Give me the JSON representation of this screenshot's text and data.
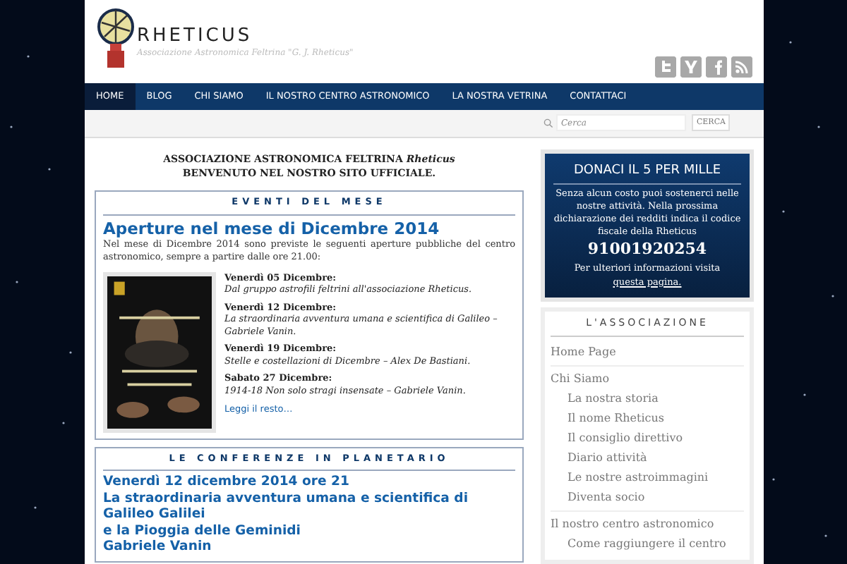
{
  "header": {
    "title": "RHETICUS",
    "subtitle": "Associazione Astronomica Feltrina \"G. J. Rheticus\""
  },
  "nav": [
    {
      "label": "HOME",
      "selected": true
    },
    {
      "label": "BLOG",
      "selected": false
    },
    {
      "label": "CHI SIAMO",
      "selected": false
    },
    {
      "label": "IL NOSTRO CENTRO ASTRONOMICO",
      "selected": false
    },
    {
      "label": "LA NOSTRA VETRINA",
      "selected": false
    },
    {
      "label": "CONTATTACI",
      "selected": false
    }
  ],
  "search": {
    "placeholder": "Cerca",
    "button": "CERCA"
  },
  "intro": [
    "ASSOCIAZIONE ASTRONOMICA FELTRINA *Rheticus*",
    "BENVENUTO NEL NOSTRO SITO UFFICIALE."
  ],
  "events": {
    "heading": "EVENTI DEL MESE",
    "title": "Aperture nel mese di Dicembre 2014",
    "text": "Nel mese di Dicembre 2014 sono previste le seguenti aperture pubbliche del centro astronomico, sempre a partire dalle ore 21.00:",
    "items": [
      {
        "date": "Venerdì 05 Dicembre:",
        "desc": "Dal gruppo astrofili feltrini all'associazione Rheticus."
      },
      {
        "date": "Venerdì 12 Dicembre:",
        "desc": "La straordinaria avventura umana e scientifica di Galileo – Gabriele Vanin."
      },
      {
        "date": "Venerdì 19 Dicembre:",
        "desc": "Stelle e costellazioni di Dicembre – Alex De Bastiani."
      },
      {
        "date": "Sabato 27 Dicembre:",
        "desc": "1914-18 Non solo stragi insensate – Gabriele Vanin."
      }
    ],
    "more": "Leggi il resto…"
  },
  "conferences": {
    "heading": "LE CONFERENZE IN PLANETARIO",
    "lines": [
      "Venerdì 12 dicembre 2014 ore 21",
      "La straordinaria avventura umana e scientifica di Galileo Galilei",
      "e la Pioggia delle Geminidi",
      "Gabriele Vanin"
    ]
  },
  "donate": {
    "title": "DONACI IL 5 PER MILLE",
    "text": "Senza alcun costo puoi sostenerci nelle nostre attività. Nella prossima dichiarazione dei redditi indica il codice fiscale della Rheticus",
    "code": "91001920254",
    "more": "Per ulteriori informazioni visita",
    "link": "questa pagina."
  },
  "association": {
    "heading": "L'ASSOCIAZIONE",
    "items": [
      {
        "label": "Home Page"
      },
      {
        "label": "Chi Siamo",
        "children": [
          {
            "label": "La nostra storia"
          },
          {
            "label": "Il nome Rheticus"
          },
          {
            "label": "Il consiglio direttivo"
          },
          {
            "label": "Diario attività"
          },
          {
            "label": "Le nostre astroimmagini"
          },
          {
            "label": "Diventa socio"
          }
        ]
      },
      {
        "label": "Il nostro centro astronomico",
        "children": [
          {
            "label": "Come raggiungere il centro"
          }
        ]
      }
    ]
  }
}
